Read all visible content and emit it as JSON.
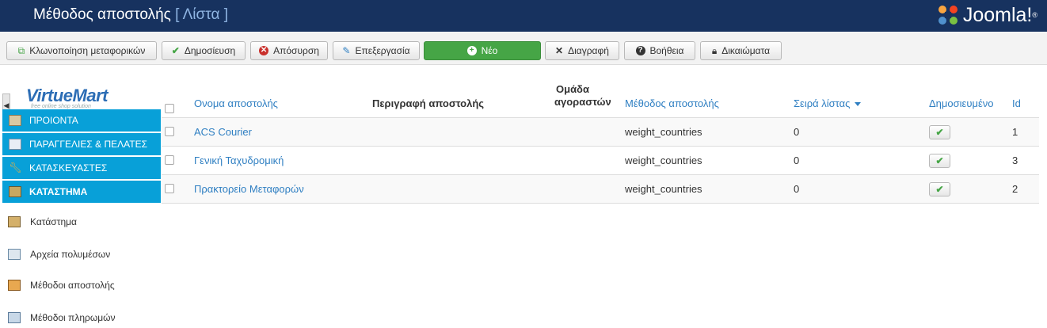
{
  "header": {
    "title": "Μέθοδος αποστολής",
    "subtitle": "[ Λίστα ]",
    "logo_text": "Joomla!"
  },
  "toolbar": {
    "clone": "Κλωνοποίηση μεταφορικών",
    "publish": "Δημοσίευση",
    "unpublish": "Απόσυρση",
    "edit": "Επεξεργασία",
    "new": "Νέο",
    "delete": "Διαγραφή",
    "help": "Βοήθεια",
    "permissions": "Δικαιώματα"
  },
  "sidebar": {
    "logo_name": "VirtueMart",
    "logo_tag": "free online shop solution",
    "sections": [
      {
        "label": "ΠΡΟΙΟΝΤΑ"
      },
      {
        "label": "ΠΑΡΑΓΓΕΛΙΕΣ & ΠΕΛΑΤΕΣ"
      },
      {
        "label": "ΚΑΤΑΣΚΕΥΑΣΤΕΣ"
      },
      {
        "label": "ΚΑΤΑΣΤΗΜΑ"
      }
    ],
    "items": [
      {
        "label": "Κατάστημα"
      },
      {
        "label": "Αρχεία πολυμέσων"
      },
      {
        "label": "Μέθοδοι αποστολής"
      },
      {
        "label": "Μέθοδοι πληρωμών"
      }
    ]
  },
  "table": {
    "headers": {
      "name": "Ονομα αποστολής",
      "description": "Περιγραφή αποστολής",
      "group_line1": "Ομάδα",
      "group_line2": "αγοραστών",
      "method": "Μέθοδος αποστολής",
      "order": "Σειρά λίστας",
      "published": "Δημοσιευμένο",
      "id": "Id"
    },
    "rows": [
      {
        "name": "ACS Courier",
        "description": "",
        "group": "",
        "method": "weight_countries",
        "order": "0",
        "published": "✔",
        "id": "1"
      },
      {
        "name": "Γενική Ταχυδρομική",
        "description": "",
        "group": "",
        "method": "weight_countries",
        "order": "0",
        "published": "✔",
        "id": "3"
      },
      {
        "name": "Πρακτορείο Μεταφορών",
        "description": "",
        "group": "",
        "method": "weight_countries",
        "order": "0",
        "published": "✔",
        "id": "2"
      }
    ]
  },
  "colors": {
    "header_bg": "#17325f",
    "menu_blue": "#08a0d8",
    "link": "#2f7fc2",
    "new_button": "#46a546"
  }
}
